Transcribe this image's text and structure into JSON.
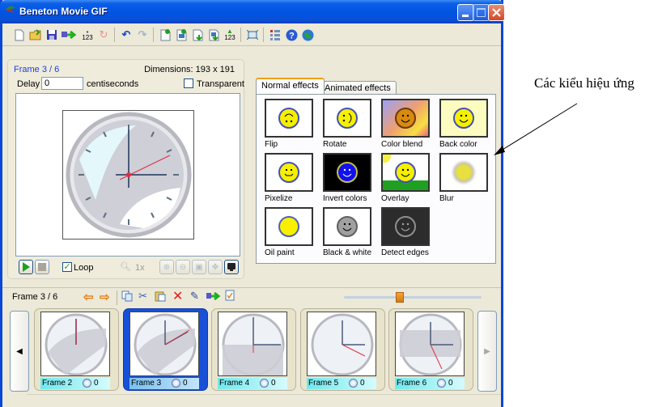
{
  "window": {
    "title": "Beneton Movie GIF",
    "controls": [
      "minimize",
      "maximize",
      "close"
    ]
  },
  "toolbar": {
    "icons": [
      "new-file-icon",
      "open-folder-icon",
      "save-icon",
      "export-icon",
      "save-numbered-icon",
      "loop-refresh-icon",
      "undo-icon",
      "redo-icon",
      "add-frame-icon",
      "insert-frame-icon",
      "import-frame-icon",
      "import-images-icon",
      "import-numbered-icon",
      "resize-icon",
      "properties-icon",
      "help-icon",
      "web-icon"
    ]
  },
  "preview": {
    "frame_label": "Frame 3 / 6",
    "dimensions": "Dimensions: 193 x 191",
    "delay_label": "Delay",
    "delay_value": "0",
    "delay_unit": "centiseconds",
    "transparent_label": "Transparent",
    "transparent_checked": false,
    "loop_label": "Loop",
    "loop_checked": true,
    "zoom_level": "1x"
  },
  "effects": {
    "tabs": [
      "Normal effects",
      "Animated effects"
    ],
    "active_tab": "Normal effects",
    "items": [
      {
        "label": "Flip"
      },
      {
        "label": "Rotate"
      },
      {
        "label": "Color blend"
      },
      {
        "label": "Back color"
      },
      {
        "label": "Pixelize"
      },
      {
        "label": "Invert colors"
      },
      {
        "label": "Overlay"
      },
      {
        "label": "Blur"
      },
      {
        "label": "Oil paint"
      },
      {
        "label": "Black & white"
      },
      {
        "label": "Detect edges"
      }
    ]
  },
  "annotation": {
    "text": "Các kiểu hiệu  ứng"
  },
  "framebar": {
    "label": "Frame 3 / 6",
    "slider_position_percent": 40
  },
  "frames": [
    {
      "label": "Frame 2",
      "delay": "0",
      "selected": false
    },
    {
      "label": "Frame 3",
      "delay": "0",
      "selected": true
    },
    {
      "label": "Frame 4",
      "delay": "0",
      "selected": false
    },
    {
      "label": "Frame 5",
      "delay": "0",
      "selected": false
    },
    {
      "label": "Frame 6",
      "delay": "0",
      "selected": false
    }
  ]
}
